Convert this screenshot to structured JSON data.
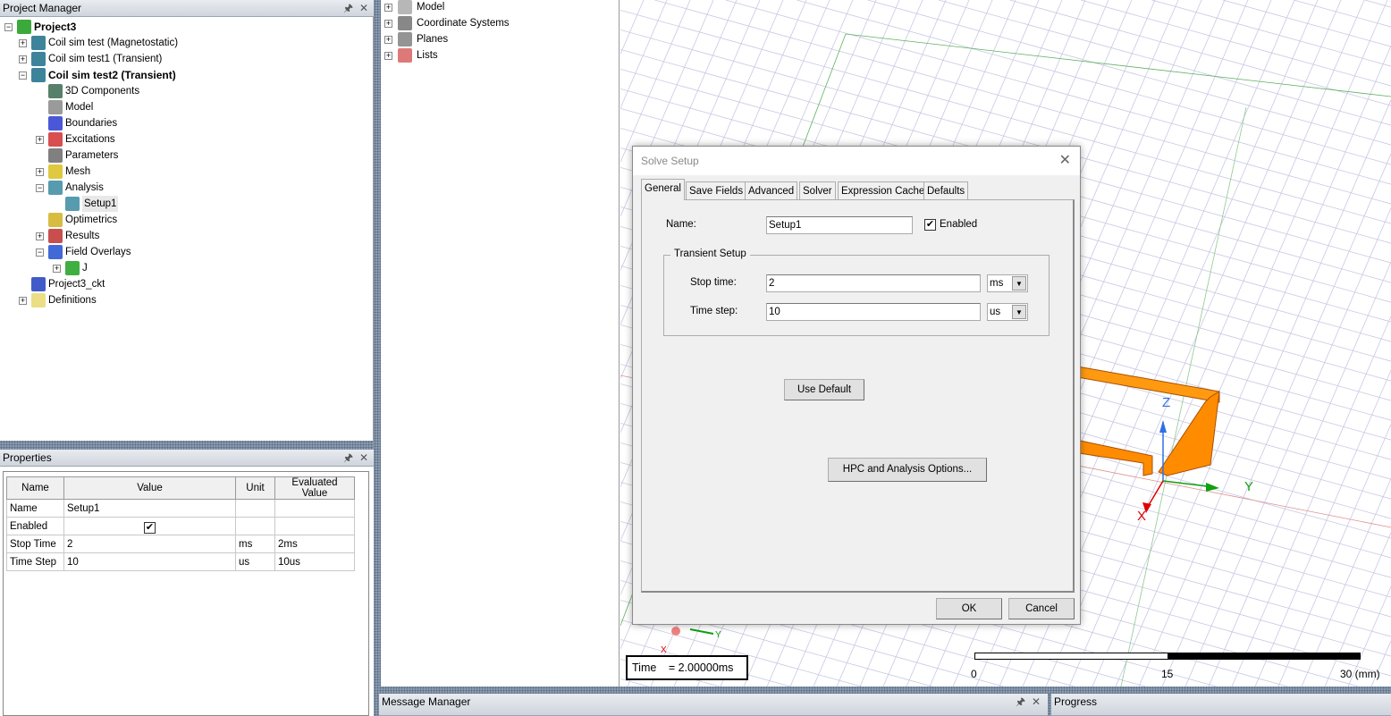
{
  "project_manager": {
    "title": "Project Manager",
    "pin_icon": "pin-icon",
    "close_icon": "close-icon",
    "tree": [
      {
        "label": "Project3",
        "level": 0,
        "exp": "-",
        "bold": true,
        "icon": "project-icon",
        "color": "#1a9a1a"
      },
      {
        "label": "Coil sim test (Magnetostatic)",
        "level": 1,
        "exp": "+",
        "icon": "design-icon",
        "color": "#1b6f8a"
      },
      {
        "label": "Coil sim test1 (Transient)",
        "level": 1,
        "exp": "+",
        "icon": "design-icon",
        "color": "#1b6f8a"
      },
      {
        "label": "Coil sim test2 (Transient)",
        "level": 1,
        "exp": "-",
        "bold": true,
        "icon": "design-icon",
        "color": "#1b6f8a"
      },
      {
        "label": "3D Components",
        "level": 2,
        "icon": "components-icon",
        "color": "#3a6a50"
      },
      {
        "label": "Model",
        "level": 2,
        "icon": "model-icon",
        "color": "#888888"
      },
      {
        "label": "Boundaries",
        "level": 2,
        "icon": "boundaries-icon",
        "color": "#2a3bd0"
      },
      {
        "label": "Excitations",
        "level": 2,
        "exp": "+",
        "icon": "excitations-icon",
        "color": "#d03030"
      },
      {
        "label": "Parameters",
        "level": 2,
        "icon": "parameters-icon",
        "color": "#6a6a6a"
      },
      {
        "label": "Mesh",
        "level": 2,
        "exp": "+",
        "icon": "mesh-icon",
        "color": "#d8c020"
      },
      {
        "label": "Analysis",
        "level": 2,
        "exp": "-",
        "icon": "analysis-icon",
        "color": "#3a8aa0"
      },
      {
        "label": "Setup1",
        "level": 3,
        "icon": "setup-icon",
        "color": "#3a8aa0",
        "selected": true
      },
      {
        "label": "Optimetrics",
        "level": 2,
        "icon": "optimetrics-icon",
        "color": "#d0b020"
      },
      {
        "label": "Results",
        "level": 2,
        "exp": "+",
        "icon": "results-icon",
        "color": "#c03030"
      },
      {
        "label": "Field Overlays",
        "level": 2,
        "exp": "-",
        "icon": "field-overlays-icon",
        "color": "#2050d0"
      },
      {
        "label": "J",
        "level": 3,
        "exp": "+",
        "icon": "field-plot-icon",
        "color": "#20a020"
      },
      {
        "label": "Project3_ckt",
        "level": 1,
        "icon": "circuit-icon",
        "color": "#2040c0"
      },
      {
        "label": "Definitions",
        "level": 1,
        "exp": "+",
        "icon": "folder-icon",
        "color": "#e8d870"
      }
    ]
  },
  "properties": {
    "title": "Properties",
    "columns": [
      "Name",
      "Value",
      "Unit",
      "Evaluated Value"
    ],
    "rows": [
      {
        "name": "Name",
        "value": "Setup1",
        "unit": "",
        "evaluated": ""
      },
      {
        "name": "Enabled",
        "value": "",
        "checked": true,
        "unit": "",
        "evaluated": ""
      },
      {
        "name": "Stop Time",
        "value": "2",
        "unit": "ms",
        "evaluated": "2ms"
      },
      {
        "name": "Time Step",
        "value": "10",
        "unit": "us",
        "evaluated": "10us"
      }
    ]
  },
  "model_tree": [
    {
      "label": "Model",
      "icon": "model-icon"
    },
    {
      "label": "Coordinate Systems",
      "icon": "coordinate-systems-icon"
    },
    {
      "label": "Planes",
      "icon": "planes-icon"
    },
    {
      "label": "Lists",
      "icon": "lists-icon"
    }
  ],
  "viewport": {
    "time_label": "Time",
    "time_value": "= 2.00000ms",
    "scale_ticks": [
      "0",
      "15",
      "30 (mm)"
    ],
    "axes": {
      "x": "X",
      "y": "Y",
      "z": "Z"
    },
    "colors": {
      "coil": "#ff8c00",
      "x_axis": "#e00000",
      "y_axis": "#10a010",
      "z_axis": "#3070e0"
    }
  },
  "dialog": {
    "title": "Solve Setup",
    "tabs": [
      "General",
      "Save Fields",
      "Advanced",
      "Solver",
      "Expression Cache",
      "Defaults"
    ],
    "name_label": "Name:",
    "name_value": "Setup1",
    "enabled_label": "Enabled",
    "enabled": true,
    "group_label": "Transient Setup",
    "stop_time_label": "Stop time:",
    "stop_time_value": "2",
    "stop_time_unit": "ms",
    "time_step_label": "Time step:",
    "time_step_value": "10",
    "time_step_unit": "us",
    "use_default": "Use Default",
    "hpc": "HPC and Analysis Options...",
    "ok": "OK",
    "cancel": "Cancel"
  },
  "bottom": {
    "message_manager": "Message Manager",
    "progress": "Progress"
  }
}
